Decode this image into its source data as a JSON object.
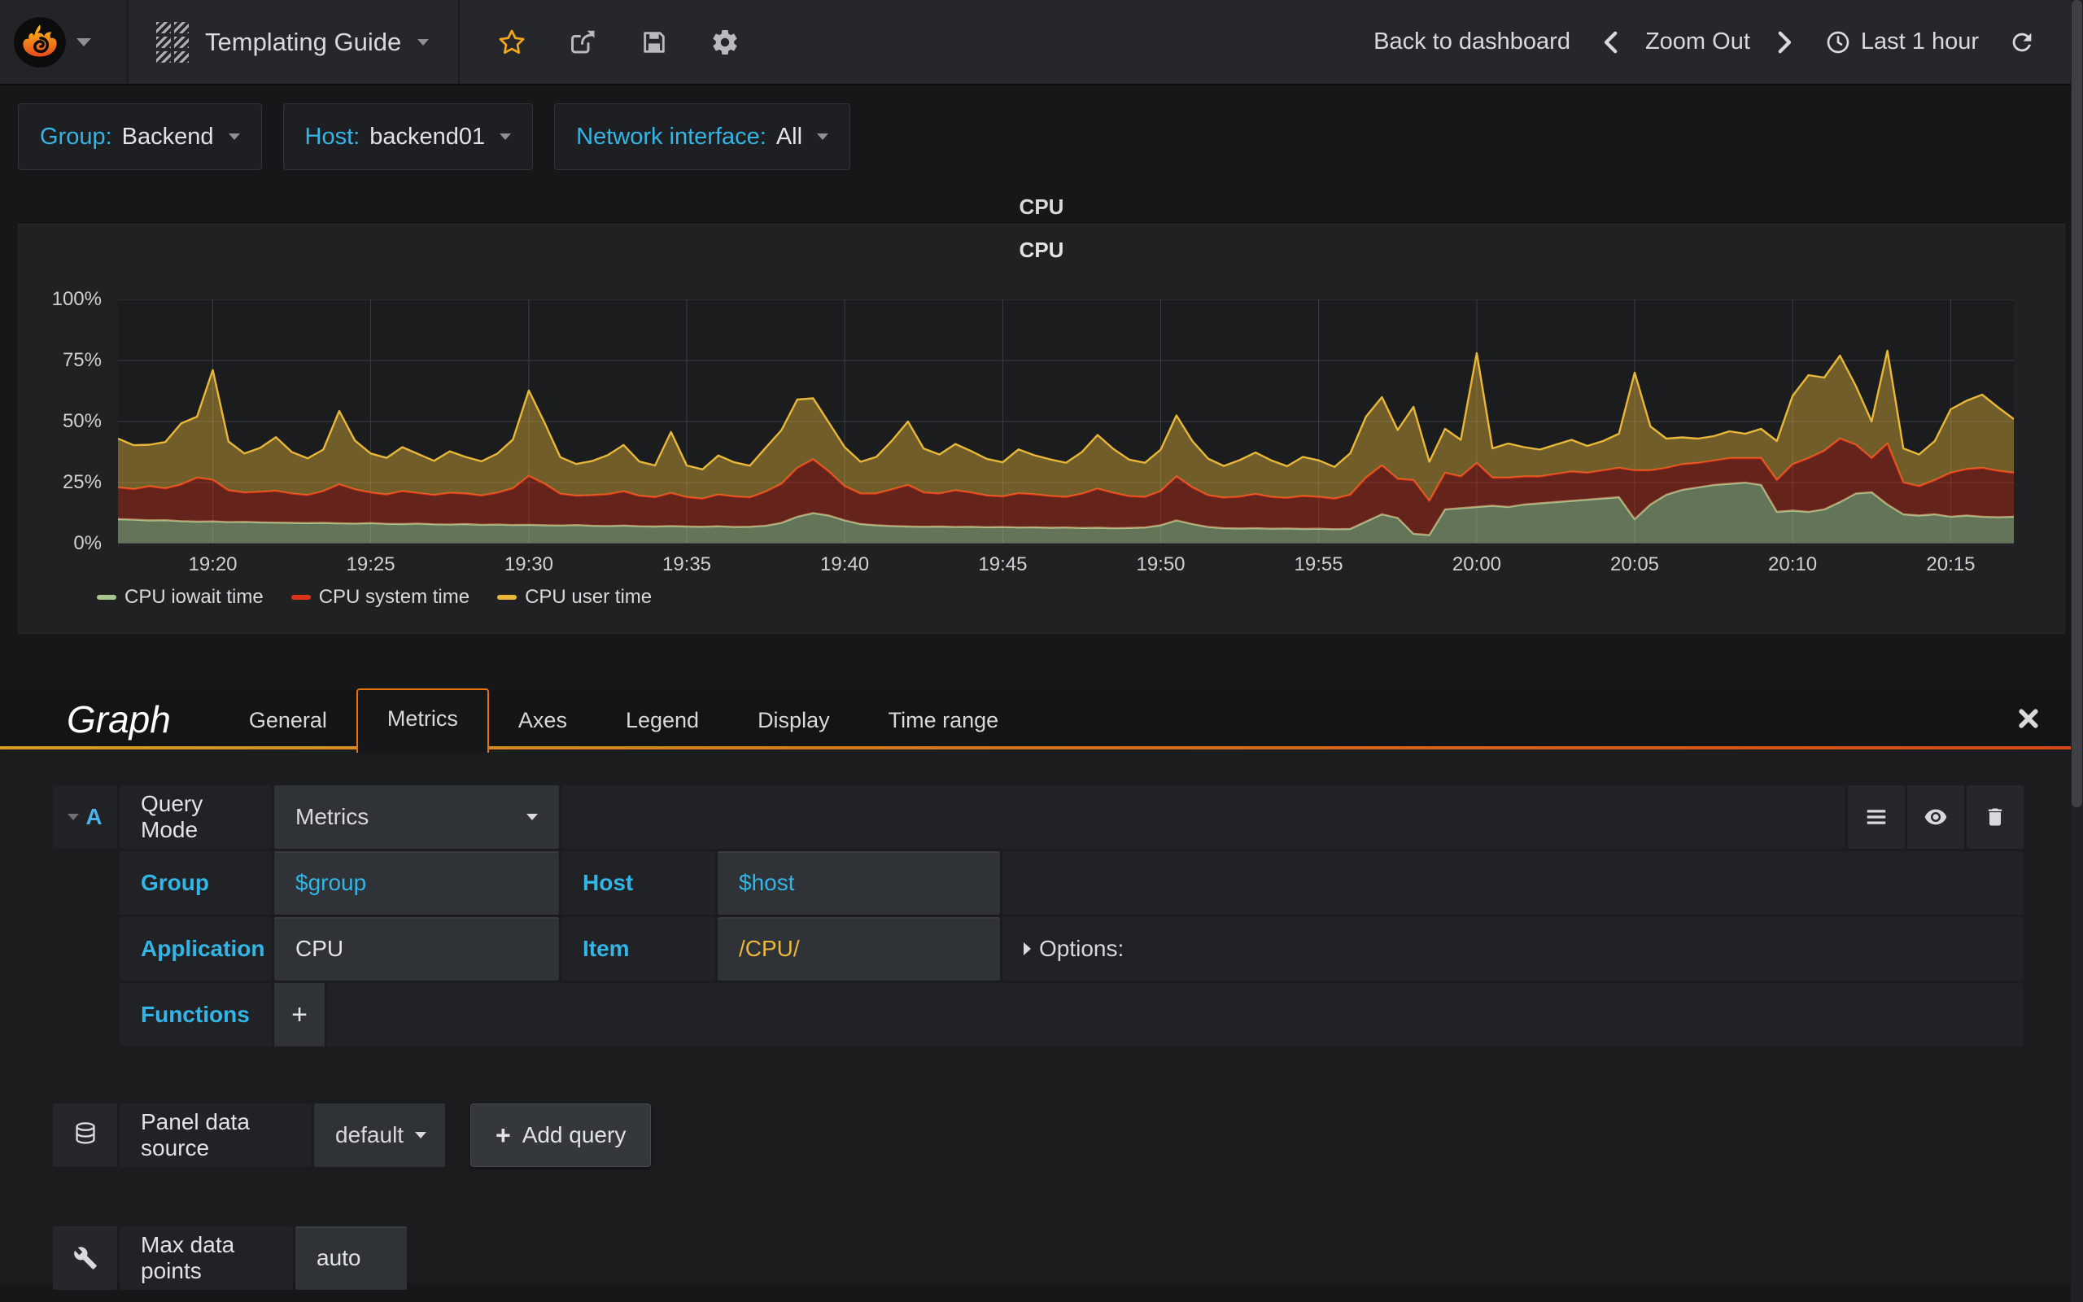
{
  "navbar": {
    "dashboard_title": "Templating Guide",
    "back_to_dashboard": "Back to dashboard",
    "zoom_out": "Zoom Out",
    "time_range": "Last 1 hour",
    "accent_star_color": "#f2a71b"
  },
  "variables": [
    {
      "label": "Group:",
      "value": "Backend"
    },
    {
      "label": "Host:",
      "value": "backend01"
    },
    {
      "label": "Network interface:",
      "value": "All"
    }
  ],
  "panel": {
    "drag_title": "CPU",
    "title": "CPU"
  },
  "chart_data": {
    "type": "area",
    "stacked": true,
    "title": "CPU",
    "unit": "%",
    "ylim": [
      0,
      100
    ],
    "y_ticks": [
      0,
      25,
      50,
      75,
      100
    ],
    "y_tick_labels": [
      "0%",
      "25%",
      "50%",
      "75%",
      "100%"
    ],
    "x_start": "19:17",
    "x_end": "20:17",
    "x_tick_labels": [
      "19:20",
      "19:25",
      "19:30",
      "19:35",
      "19:40",
      "19:45",
      "19:50",
      "19:55",
      "20:00",
      "20:05",
      "20:10",
      "20:15"
    ],
    "x_tick_fractions": [
      0.05,
      0.1333,
      0.2167,
      0.3,
      0.3833,
      0.4667,
      0.55,
      0.6333,
      0.7167,
      0.8,
      0.8833,
      0.9667
    ],
    "grid": true,
    "legend_position": "bottom",
    "background": "#1a1c1e",
    "grid_color": "#3a3d42",
    "series": [
      {
        "name": "CPU iowait time",
        "color": "#a8c68f",
        "fill_color": "rgba(168,198,143,0.52)",
        "values": [
          10,
          9.8,
          9.5,
          9.6,
          9.2,
          9,
          9.1,
          8.8,
          8.9,
          8.7,
          8.6,
          8.5,
          8.4,
          8.5,
          8.3,
          8.2,
          8.4,
          8.1,
          8,
          8.2,
          7.9,
          7.8,
          8,
          7.7,
          7.8,
          7.6,
          7.7,
          7.5,
          7.4,
          7.6,
          7.3,
          7.2,
          7.4,
          7.1,
          7,
          7.2,
          7,
          6.9,
          7.1,
          6.8,
          6.9,
          7.3,
          8.5,
          11,
          12.5,
          11.5,
          9.5,
          8,
          7.5,
          7.2,
          7,
          6.9,
          7,
          6.8,
          6.9,
          6.7,
          6.8,
          6.6,
          6.7,
          6.5,
          6.6,
          6.4,
          6.5,
          6.3,
          6.4,
          6.6,
          7.5,
          9.5,
          8,
          6.8,
          6.3,
          6.2,
          6.3,
          6.1,
          6.2,
          6,
          6.1,
          5.9,
          6,
          9,
          12,
          10.5,
          4,
          3.5,
          14,
          14.5,
          15,
          15.5,
          15,
          16,
          16.5,
          17,
          17.5,
          18,
          18.5,
          19,
          10,
          16,
          20,
          22,
          23,
          24,
          24.5,
          25,
          24,
          13,
          13.5,
          13,
          14,
          17,
          20.5,
          21,
          16,
          12,
          11.5,
          12,
          11,
          11.5,
          11,
          10.8,
          11
        ]
      },
      {
        "name": "CPU system time",
        "color": "#dd3318",
        "fill_color": "rgba(221,51,24,0.38)",
        "values": [
          13,
          12.5,
          14,
          13,
          15,
          18,
          17,
          13,
          12,
          12.5,
          13,
          12,
          11.5,
          13,
          16,
          14,
          12.5,
          12,
          13.5,
          12.5,
          12,
          13,
          12.5,
          12,
          13,
          15,
          20,
          17,
          13,
          12,
          12.5,
          13,
          14,
          12.5,
          12,
          13.5,
          12,
          11.5,
          13,
          12.5,
          12,
          14,
          16,
          20,
          22,
          18,
          14,
          12.5,
          13,
          15,
          17,
          14,
          13.5,
          15,
          14,
          13,
          12.5,
          14,
          13.5,
          13,
          12.5,
          14,
          16,
          14.5,
          13,
          12.5,
          14,
          18,
          15,
          13,
          12.5,
          13,
          14,
          13,
          12.5,
          13.5,
          13,
          12.5,
          14,
          18,
          20,
          16,
          22,
          14,
          15,
          13,
          18,
          11.5,
          12,
          11.5,
          11,
          11.5,
          12,
          11,
          11.5,
          12,
          20,
          14,
          11,
          10.5,
          10,
          10,
          10.5,
          10,
          11,
          13,
          19,
          22,
          24,
          26,
          20,
          14,
          25,
          13,
          12,
          14,
          18,
          19,
          20,
          19,
          18
        ]
      },
      {
        "name": "CPU user time",
        "color": "#eab839",
        "fill_color": "rgba(234,184,57,0.42)",
        "values": [
          20,
          18,
          17,
          19,
          25,
          25,
          45,
          20,
          16,
          18,
          22,
          17,
          15,
          17,
          30,
          20,
          16,
          15,
          18,
          16,
          14,
          17,
          15,
          14,
          16,
          20,
          35,
          25,
          15,
          13,
          14,
          16,
          19,
          14,
          13,
          25,
          13,
          12,
          16,
          14,
          13,
          18,
          22,
          28,
          25,
          20,
          16,
          13,
          15,
          20,
          26,
          18,
          16,
          19,
          17,
          15,
          14,
          18,
          16,
          15,
          14,
          17,
          22,
          18,
          15,
          14,
          17,
          25,
          19,
          15,
          13,
          15,
          17,
          15,
          13,
          16,
          15,
          13,
          17,
          25,
          28,
          20,
          30,
          16,
          18,
          15,
          45,
          12,
          14,
          12,
          11,
          12,
          13,
          11,
          12,
          14,
          40,
          18,
          12,
          11,
          10,
          10,
          11,
          10,
          12,
          16,
          28,
          34,
          30,
          34,
          24,
          15,
          38,
          14,
          13,
          16,
          26,
          28,
          30,
          26,
          22
        ]
      }
    ]
  },
  "editor": {
    "panel_type": "Graph",
    "tabs": [
      {
        "label": "General",
        "active": false
      },
      {
        "label": "Metrics",
        "active": true
      },
      {
        "label": "Axes",
        "active": false
      },
      {
        "label": "Legend",
        "active": false
      },
      {
        "label": "Display",
        "active": false
      },
      {
        "label": "Time range",
        "active": false
      }
    ]
  },
  "query": {
    "ref_letter": "A",
    "query_mode_label": "Query Mode",
    "query_mode_value": "Metrics",
    "group_label": "Group",
    "group_value": "$group",
    "host_label": "Host",
    "host_value": "$host",
    "application_label": "Application",
    "application_value": "CPU",
    "item_label": "Item",
    "item_value": "/CPU/",
    "options_label": "Options:",
    "functions_label": "Functions",
    "add_function_label": "+"
  },
  "datasource": {
    "label": "Panel data source",
    "value": "default",
    "add_query_label": "Add query",
    "plus": "+"
  },
  "settings": {
    "max_data_points_label": "Max data points",
    "max_data_points_placeholder": "auto",
    "max_data_points_value": ""
  }
}
